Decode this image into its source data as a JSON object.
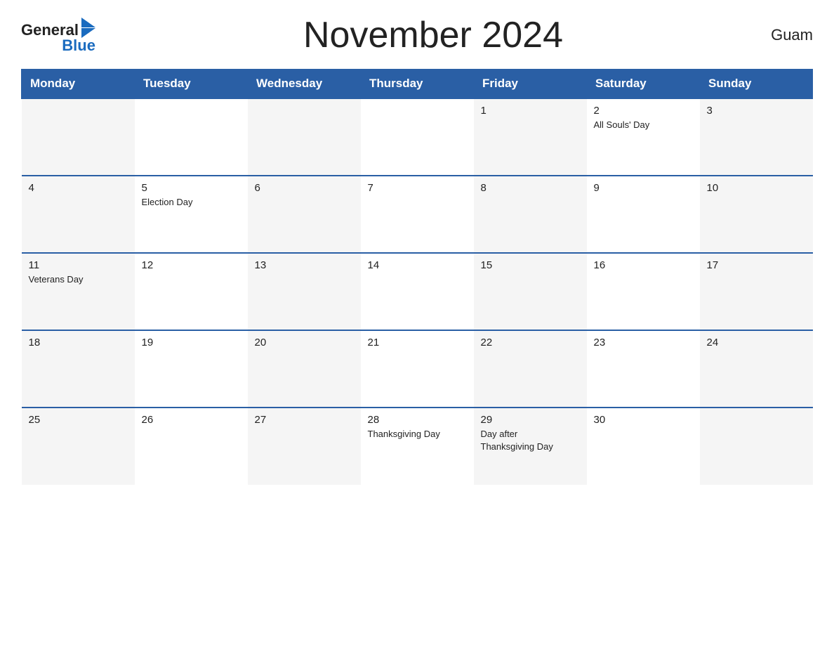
{
  "header": {
    "logo_general": "General",
    "logo_blue": "Blue",
    "title": "November 2024",
    "region": "Guam"
  },
  "weekdays": [
    "Monday",
    "Tuesday",
    "Wednesday",
    "Thursday",
    "Friday",
    "Saturday",
    "Sunday"
  ],
  "weeks": [
    [
      {
        "day": "",
        "event": ""
      },
      {
        "day": "",
        "event": ""
      },
      {
        "day": "",
        "event": ""
      },
      {
        "day": "",
        "event": ""
      },
      {
        "day": "1",
        "event": ""
      },
      {
        "day": "2",
        "event": "All Souls' Day"
      },
      {
        "day": "3",
        "event": ""
      }
    ],
    [
      {
        "day": "4",
        "event": ""
      },
      {
        "day": "5",
        "event": "Election Day"
      },
      {
        "day": "6",
        "event": ""
      },
      {
        "day": "7",
        "event": ""
      },
      {
        "day": "8",
        "event": ""
      },
      {
        "day": "9",
        "event": ""
      },
      {
        "day": "10",
        "event": ""
      }
    ],
    [
      {
        "day": "11",
        "event": "Veterans Day"
      },
      {
        "day": "12",
        "event": ""
      },
      {
        "day": "13",
        "event": ""
      },
      {
        "day": "14",
        "event": ""
      },
      {
        "day": "15",
        "event": ""
      },
      {
        "day": "16",
        "event": ""
      },
      {
        "day": "17",
        "event": ""
      }
    ],
    [
      {
        "day": "18",
        "event": ""
      },
      {
        "day": "19",
        "event": ""
      },
      {
        "day": "20",
        "event": ""
      },
      {
        "day": "21",
        "event": ""
      },
      {
        "day": "22",
        "event": ""
      },
      {
        "day": "23",
        "event": ""
      },
      {
        "day": "24",
        "event": ""
      }
    ],
    [
      {
        "day": "25",
        "event": ""
      },
      {
        "day": "26",
        "event": ""
      },
      {
        "day": "27",
        "event": ""
      },
      {
        "day": "28",
        "event": "Thanksgiving Day"
      },
      {
        "day": "29",
        "event": "Day after\nThanksgiving Day"
      },
      {
        "day": "30",
        "event": ""
      },
      {
        "day": "",
        "event": ""
      }
    ]
  ]
}
